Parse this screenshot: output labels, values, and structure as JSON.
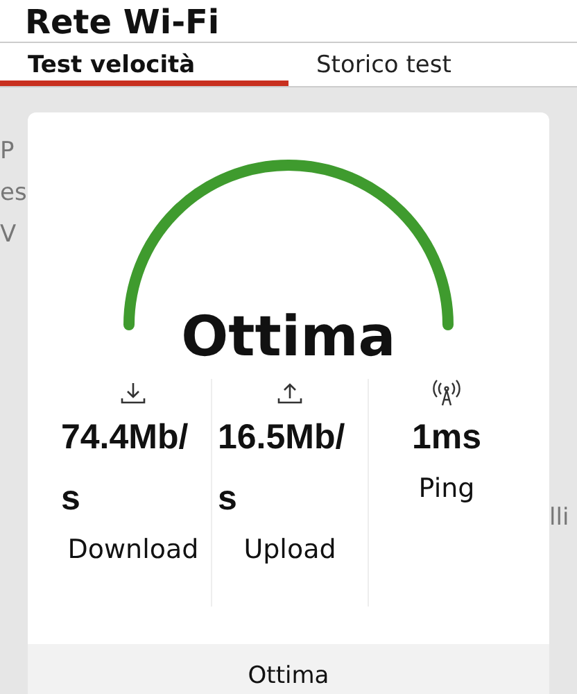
{
  "header": {
    "title": "Rete Wi-Fi"
  },
  "tabs": [
    {
      "label": "Test velocità",
      "selected": true
    },
    {
      "label": "Storico test",
      "selected": false
    }
  ],
  "background_text": {
    "left": [
      "P",
      "es",
      "V"
    ],
    "right": [
      "lli"
    ]
  },
  "result": {
    "rating": "Ottima",
    "stats": [
      {
        "kind": "download",
        "value": "74.4Mb/s",
        "label": "Download"
      },
      {
        "kind": "upload",
        "value": "16.5Mb/s",
        "label": "Upload"
      },
      {
        "kind": "ping",
        "value": "1ms",
        "label": "Ping"
      }
    ],
    "footer": "Ottima"
  }
}
